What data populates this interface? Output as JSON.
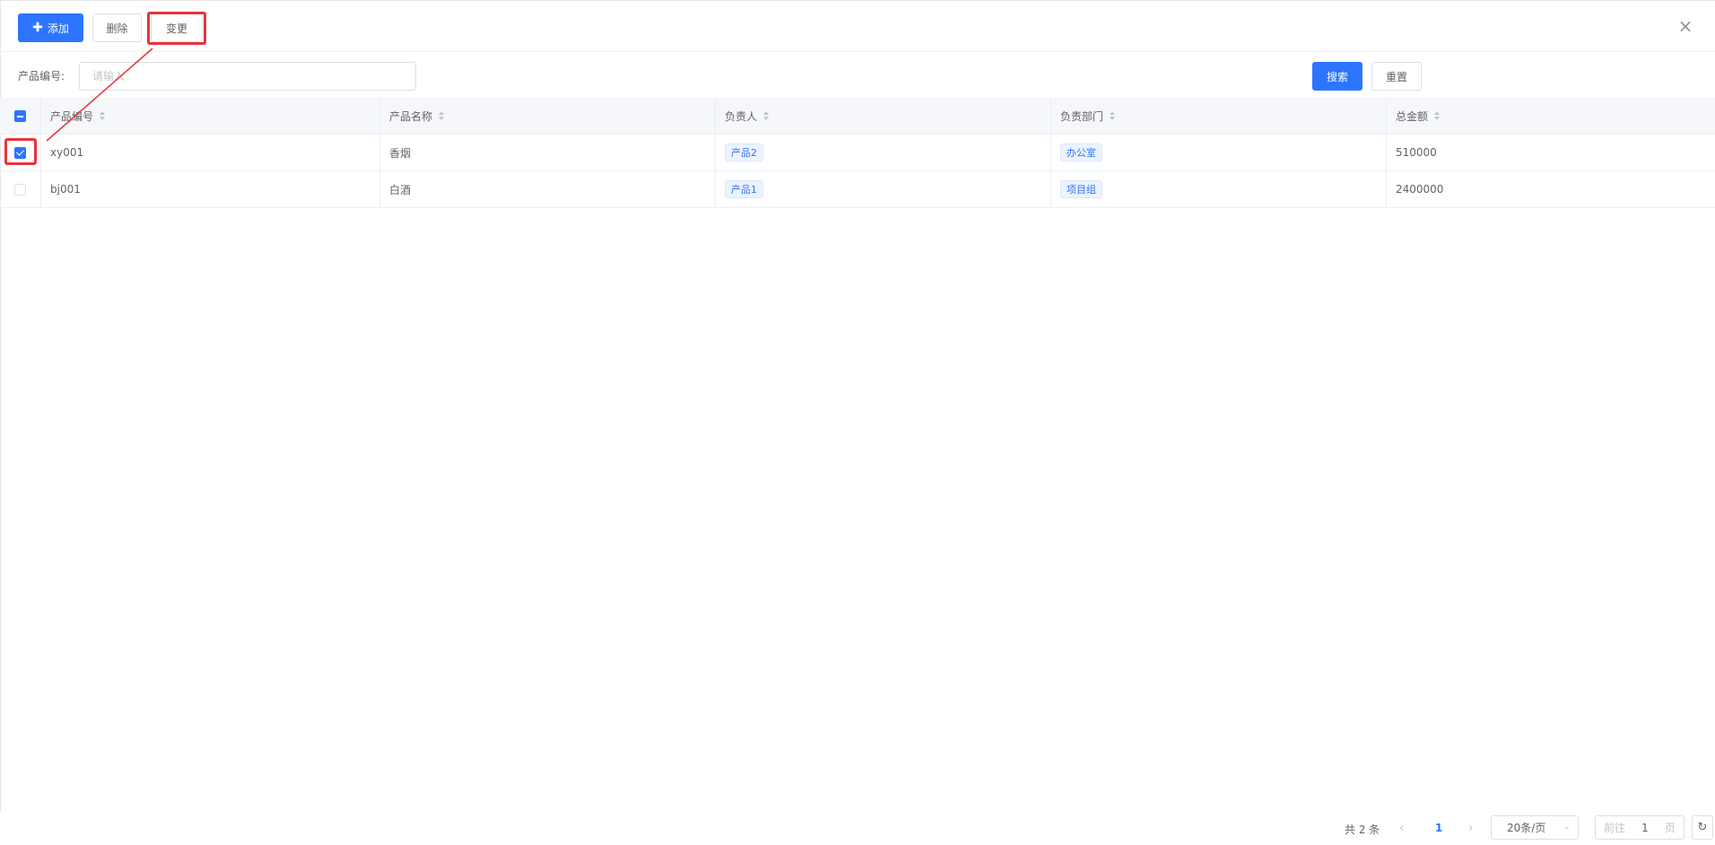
{
  "toolbar": {
    "add_label": "添加",
    "delete_label": "删除",
    "change_label": "变更",
    "close_glyph": "×"
  },
  "search": {
    "label": "产品编号:",
    "placeholder": "请输入",
    "value": "",
    "search_button": "搜索",
    "reset_button": "重置"
  },
  "table": {
    "columns": [
      "产品编号",
      "产品名称",
      "负责人",
      "负责部门",
      "总金额"
    ],
    "rows": [
      {
        "checked": true,
        "code": "xy001",
        "name": "香烟",
        "owner": "产品2",
        "dept": "办公室",
        "amount": "510000"
      },
      {
        "checked": false,
        "code": "bj001",
        "name": "白酒",
        "owner": "产品1",
        "dept": "项目组",
        "amount": "2400000"
      }
    ]
  },
  "pagination": {
    "total": "共 2 条",
    "prev_glyph": "‹",
    "current_page": "1",
    "next_glyph": "›",
    "page_size": "20条/页",
    "size_chevron": "⌄",
    "goto_label": "前往",
    "goto_value": "1",
    "page_unit": "页",
    "refresh_glyph": "↻"
  },
  "colors": {
    "primary": "#2d74ff",
    "highlight": "#e8333a"
  }
}
